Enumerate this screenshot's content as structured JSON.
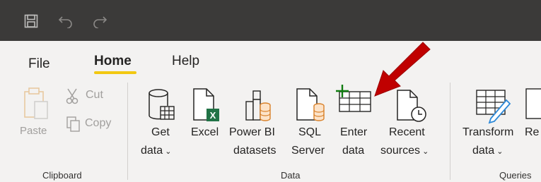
{
  "titlebar": {
    "save_icon": "save-icon",
    "undo_icon": "undo-icon",
    "redo_icon": "redo-icon"
  },
  "tabs": [
    {
      "label": "File"
    },
    {
      "label": "Home"
    },
    {
      "label": "Help"
    }
  ],
  "clipboard": {
    "paste": "Paste",
    "cut": "Cut",
    "copy": "Copy",
    "group": "Clipboard"
  },
  "data_group": {
    "get_data_line1": "Get",
    "get_data_line2": "data",
    "excel": "Excel",
    "power_bi_line1": "Power BI",
    "power_bi_line2": "datasets",
    "sql_line1": "SQL",
    "sql_line2": "Server",
    "enter_line1": "Enter",
    "enter_line2": "data",
    "recent_line1": "Recent",
    "recent_line2": "sources",
    "group": "Data"
  },
  "queries_group": {
    "transform_line1": "Transform",
    "transform_line2": "data",
    "partial_label": "Re",
    "group": "Queries"
  },
  "colors": {
    "titlebar": "#3b3a39",
    "ribbon": "#f3f2f1",
    "accent": "#f2c811",
    "annotation_arrow": "#c00000",
    "excel_green": "#217346",
    "db_orange": "#d9822b"
  }
}
